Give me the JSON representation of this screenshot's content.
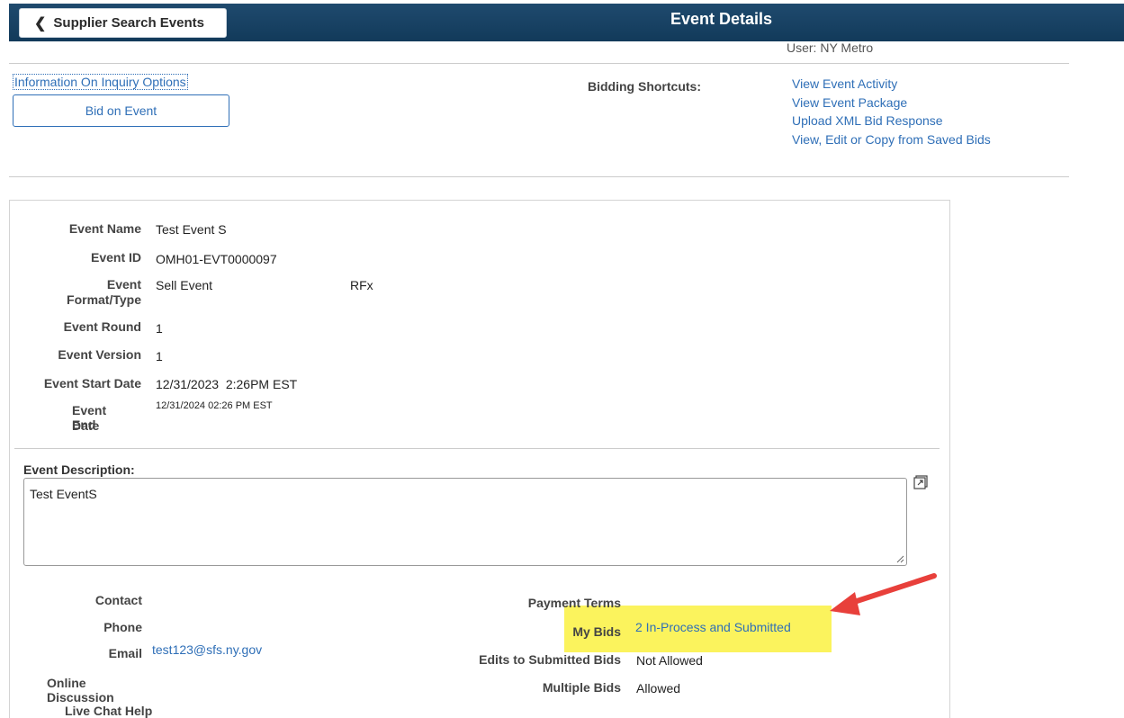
{
  "header": {
    "back_label": "Supplier Search Events",
    "title": "Event Details",
    "bg_color": "#163f61"
  },
  "user": "User: NY Metro",
  "info_link": "Information On Inquiry Options",
  "bid_button": "Bid on Event",
  "shortcuts": {
    "label": "Bidding Shortcuts:",
    "items": [
      "View Event Activity",
      "View Event Package",
      "Upload XML Bid Response",
      "View, Edit or Copy from Saved Bids"
    ]
  },
  "event": {
    "name_label": "Event Name",
    "name": "Test Event S",
    "id_label": "Event ID",
    "id": "OMH01-EVT0000097",
    "format_label_1": "Event",
    "format_label_2": "Format/Type",
    "format": "Sell Event",
    "type": "RFx",
    "round_label": "Event Round",
    "round": "1",
    "version_label": "Event Version",
    "version": "1",
    "start_label": "Event Start Date",
    "start": "12/31/2023  2:26PM EST",
    "end_label_1": "Event End",
    "end_label_2": "Date",
    "end": "12/31/2024 02:26 PM EST"
  },
  "description": {
    "label": "Event Description:",
    "value": "Test EventS"
  },
  "contact": {
    "contact_label": "Contact",
    "phone_label": "Phone",
    "email_label": "Email",
    "email": "test123@sfs.ny.gov",
    "discussion_label": "Online Discussion",
    "chat_label": "Live Chat Help"
  },
  "terms": {
    "payment_label": "Payment Terms",
    "mybids_label": "My Bids",
    "mybids": "2 In-Process and Submitted",
    "edits_label": "Edits to Submitted Bids",
    "edits": "Not Allowed",
    "multiple_label": "Multiple Bids",
    "multiple": "Allowed"
  },
  "colors": {
    "link": "#2f6fb7",
    "highlight": "#fbf35d",
    "annotation_arrow": "#e8403b"
  }
}
